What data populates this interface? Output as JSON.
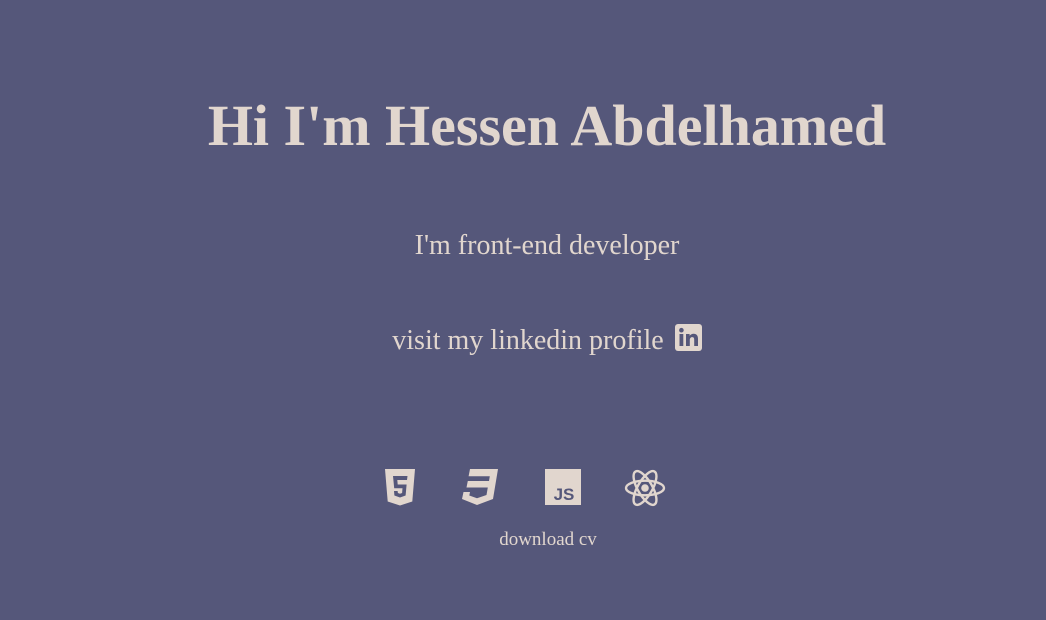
{
  "hero": {
    "title": "Hi I'm Hessen Abdelhamed",
    "subtitle": "I'm front-end developer"
  },
  "linkedin": {
    "label": "visit my linkedin profile",
    "icon": "linkedin-icon"
  },
  "tech_stack": [
    {
      "name": "HTML5",
      "icon": "html5-icon"
    },
    {
      "name": "CSS3",
      "icon": "css3-icon"
    },
    {
      "name": "JS",
      "icon": "javascript-icon"
    },
    {
      "name": "React",
      "icon": "react-icon"
    }
  ],
  "download": {
    "label": "download cv"
  },
  "colors": {
    "background": "#55577a",
    "text": "#e1d6ce"
  }
}
